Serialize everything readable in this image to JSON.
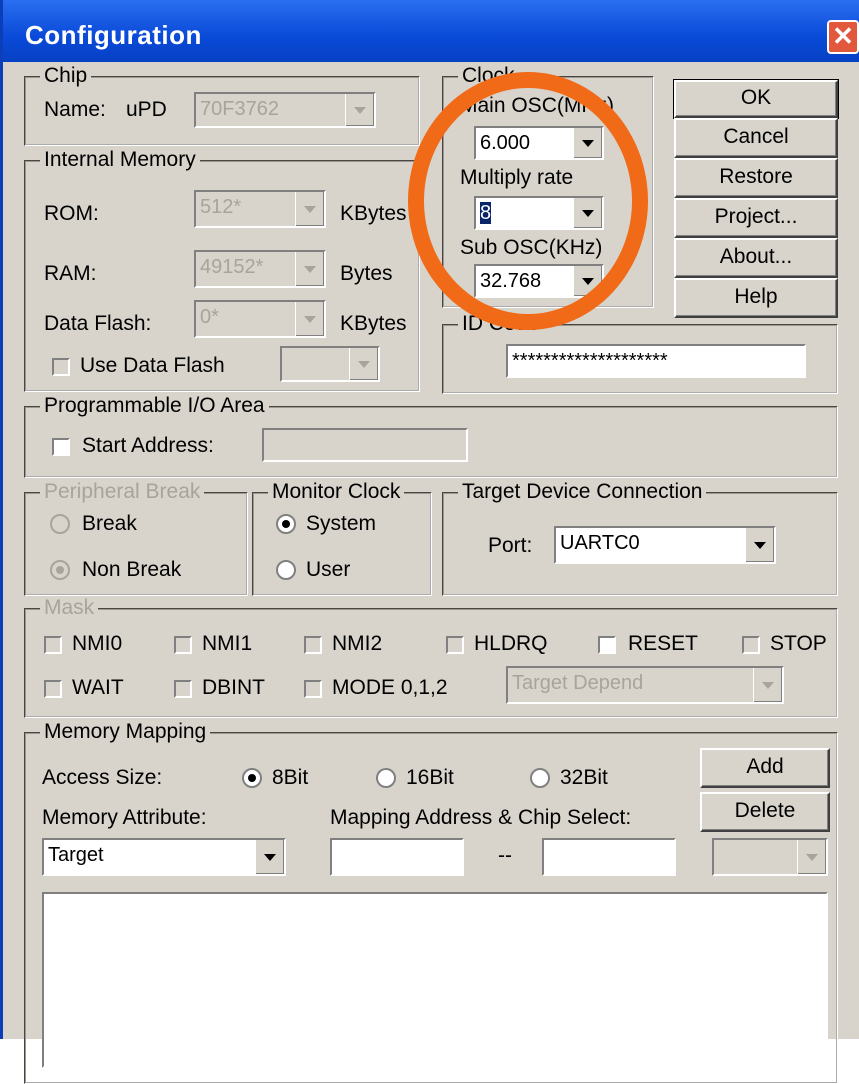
{
  "window": {
    "title": "Configuration",
    "close_glyph": "✕"
  },
  "chip": {
    "legend": "Chip",
    "name_label": "Name:",
    "prefix": "uPD",
    "value": "70F3762"
  },
  "internal_memory": {
    "legend": "Internal Memory",
    "rom": {
      "label": "ROM:",
      "value": "512*",
      "unit": "KBytes"
    },
    "ram": {
      "label": "RAM:",
      "value": "49152*",
      "unit": "Bytes"
    },
    "data_flash": {
      "label": "Data Flash:",
      "value": "0*",
      "unit": "KBytes"
    },
    "use_data_flash": {
      "label": "Use Data Flash",
      "value": ""
    }
  },
  "clock": {
    "legend": "Clock",
    "main_osc_label": "Main OSC(MHz)",
    "main_osc_value": "6.000",
    "multiply_label": "Multiply rate",
    "multiply_value": "8",
    "sub_osc_label": "Sub OSC(KHz)",
    "sub_osc_value": "32.768"
  },
  "buttons": {
    "ok": "OK",
    "cancel": "Cancel",
    "restore": "Restore",
    "project": "Project...",
    "about": "About...",
    "help": "Help"
  },
  "id_code": {
    "legend": "ID Code",
    "value": "********************"
  },
  "programmable_io": {
    "legend": "Programmable I/O Area",
    "start_address_label": "Start Address:",
    "value": ""
  },
  "peripheral_break": {
    "legend": "Peripheral Break",
    "option_break": "Break",
    "option_non_break": "Non Break"
  },
  "monitor_clock": {
    "legend": "Monitor Clock",
    "option_system": "System",
    "option_user": "User"
  },
  "target_device": {
    "legend": "Target Device Connection",
    "port_label": "Port:",
    "port_value": "UARTC0"
  },
  "mask": {
    "legend": "Mask",
    "nmi0": "NMI0",
    "nmi1": "NMI1",
    "nmi2": "NMI2",
    "hldrq": "HLDRQ",
    "reset": "RESET",
    "stop": "STOP",
    "wait": "WAIT",
    "dbint": "DBINT",
    "mode": "MODE 0,1,2",
    "target_depend": "Target Depend"
  },
  "memory_mapping": {
    "legend": "Memory Mapping",
    "access_size_label": "Access Size:",
    "opt_8bit": "8Bit",
    "opt_16bit": "16Bit",
    "opt_32bit": "32Bit",
    "memory_attribute_label": "Memory Attribute:",
    "mapping_label": "Mapping Address & Chip Select:",
    "attribute_value": "Target",
    "range_sep": "--",
    "add": "Add",
    "delete": "Delete"
  },
  "colors": {
    "title_bar": "#0a4ad8",
    "annotation_circle": "#f06a18",
    "dialog_bg": "#d8d4cc"
  }
}
